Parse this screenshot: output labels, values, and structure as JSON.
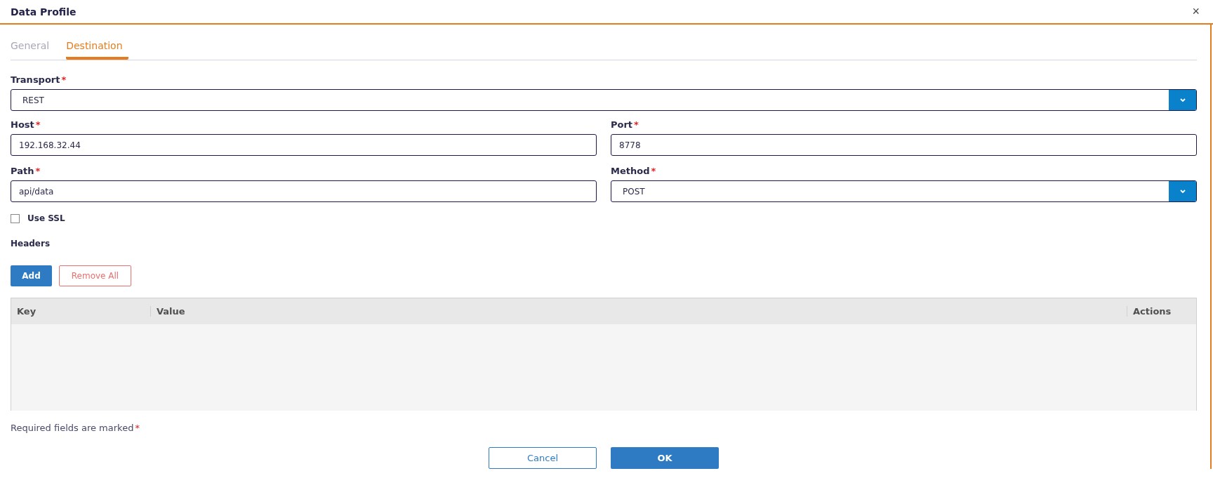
{
  "dialog": {
    "title": "Data Profile",
    "close": "×"
  },
  "tabs": [
    {
      "label": "General",
      "selected": false
    },
    {
      "label": "Destination",
      "selected": true
    }
  ],
  "transport": {
    "label": "Transport",
    "mark": "*",
    "kind": "select",
    "value": "REST"
  },
  "fields": [
    {
      "label": "Host",
      "mark": "*",
      "kind": "text",
      "value": "192.168.32.44"
    },
    {
      "label": "Port",
      "mark": "*",
      "kind": "text",
      "value": "8778"
    },
    {
      "label": "Path",
      "mark": "*",
      "kind": "text",
      "value": "api/data"
    },
    {
      "label": "Method",
      "mark": "*",
      "kind": "select",
      "value": "POST"
    }
  ],
  "use_ssl": {
    "label": "Use SSL",
    "checked": false
  },
  "headers": {
    "title": "Headers",
    "buttons": [
      "Add",
      "Remove All"
    ],
    "columns": [
      "Key",
      "Value",
      "Actions"
    ]
  },
  "footer": {
    "note": "Required fields are marked",
    "mark": "*",
    "buttons": [
      "Cancel",
      "OK"
    ]
  }
}
